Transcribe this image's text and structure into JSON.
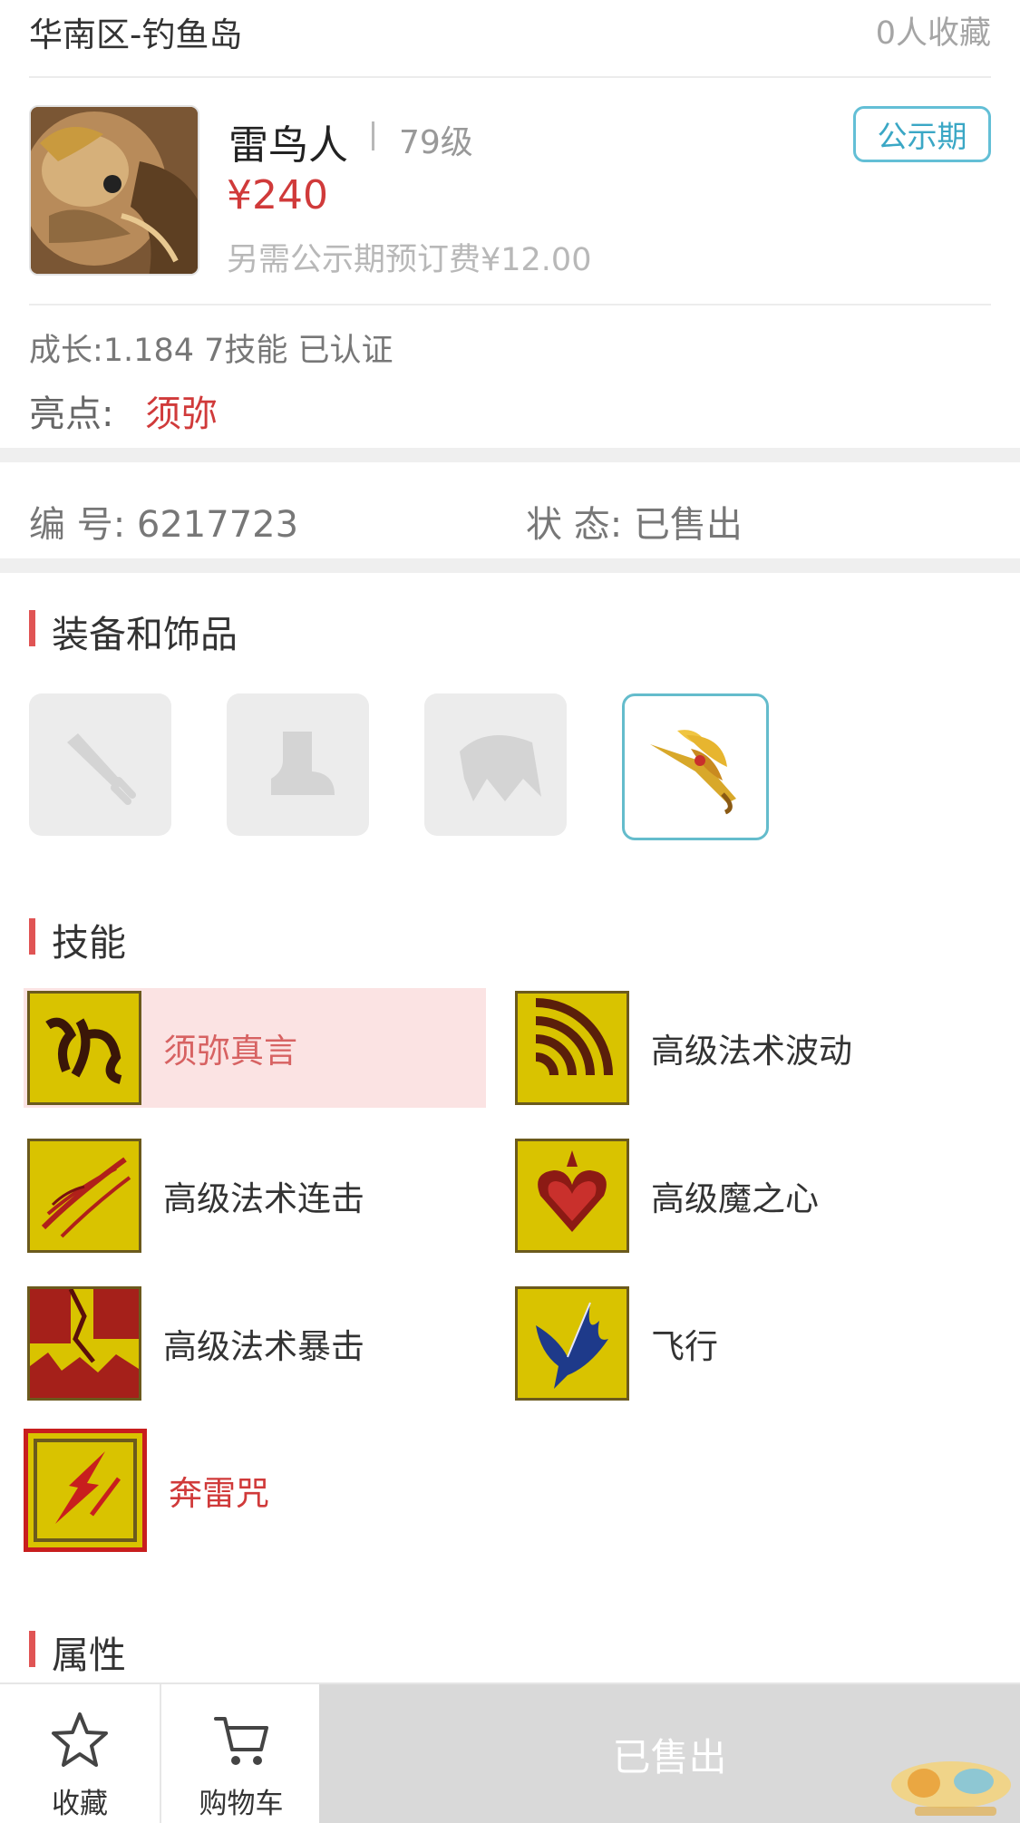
{
  "header": {
    "region": "华南区-钓鱼岛",
    "fav_count": "0人收藏"
  },
  "pet": {
    "name": "雷鸟人",
    "level": "79级",
    "price": "¥240",
    "extra_fee": "另需公示期预订费¥12.00",
    "badge": "公示期",
    "growth": "成长:1.184 7技能 已认证",
    "highlight_label": "亮点:",
    "highlight_value": "须弥"
  },
  "info": {
    "id_label": "编  号: 6217723",
    "status_label": "状  态: 已售出"
  },
  "sections": {
    "equipment": "装备和饰品",
    "skills": "技能",
    "attributes": "属性"
  },
  "equipment": [
    {
      "icon": "sword-icon",
      "filled": false
    },
    {
      "icon": "boot-icon",
      "filled": false
    },
    {
      "icon": "armor-icon",
      "filled": false
    },
    {
      "icon": "golden-wing-ornament-icon",
      "filled": true
    }
  ],
  "skills": [
    {
      "name": "须弥真言",
      "icon": "sumeru-mantra-icon",
      "style": "highlight"
    },
    {
      "name": "高级法术波动",
      "icon": "spell-wave-icon",
      "style": "normal"
    },
    {
      "name": "高级法术连击",
      "icon": "spell-combo-icon",
      "style": "normal"
    },
    {
      "name": "高级魔之心",
      "icon": "demon-heart-icon",
      "style": "normal"
    },
    {
      "name": "高级法术暴击",
      "icon": "spell-crit-icon",
      "style": "normal"
    },
    {
      "name": "飞行",
      "icon": "flight-icon",
      "style": "normal"
    },
    {
      "name": "奔雷咒",
      "icon": "thunder-spell-icon",
      "style": "special"
    }
  ],
  "bottom_bar": {
    "favorite_label": "收藏",
    "cart_label": "购物车",
    "action_label": "已售出"
  },
  "colors": {
    "accent_red": "#d03a3a",
    "badge_blue": "#3aa7c5",
    "section_marker": "#e05454"
  }
}
